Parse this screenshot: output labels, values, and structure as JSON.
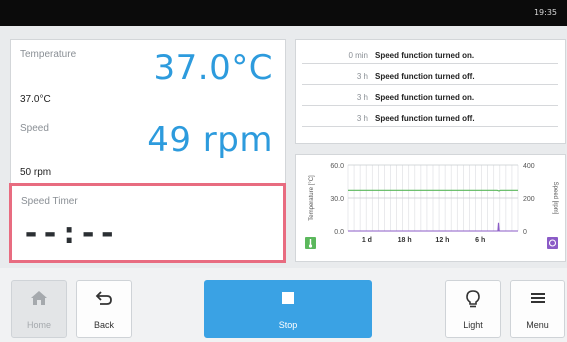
{
  "status": {
    "clock": "19:35"
  },
  "parameters": {
    "temperature": {
      "label": "Temperature",
      "actual": "37.0°C",
      "setpoint": "37.0°C"
    },
    "speed": {
      "label": "Speed",
      "actual": "49 rpm",
      "setpoint": "50 rpm"
    },
    "speed_timer": {
      "label": "Speed Timer",
      "value": "--:--"
    }
  },
  "event_log": [
    {
      "time": "0 min",
      "message": "Speed function turned on."
    },
    {
      "time": "3 h",
      "message": "Speed function turned off."
    },
    {
      "time": "3 h",
      "message": "Speed function turned on."
    },
    {
      "time": "3 h",
      "message": "Speed function turned off."
    }
  ],
  "chart_data": {
    "type": "line",
    "ylabel": "Temperature [°C]",
    "y2label": "Speed [rpm]",
    "ylim": [
      0,
      60
    ],
    "y_ticks": [
      "60.0",
      "30.0",
      "0.0"
    ],
    "y2lim": [
      0,
      400
    ],
    "y2_ticks": [
      "400",
      "200",
      "0"
    ],
    "x_ticks": [
      "1 d",
      "18 h",
      "12 h",
      "6 h"
    ],
    "xlim_hours_ago": [
      27,
      0
    ],
    "grid": true,
    "series": [
      {
        "axis": "left",
        "color": "#5bb85c",
        "points": [
          [
            27,
            37.0
          ],
          [
            3.3,
            37.0
          ],
          [
            3.0,
            36.4
          ],
          [
            2.8,
            37.0
          ],
          [
            0,
            37.0
          ]
        ]
      },
      {
        "axis": "right",
        "color": "#8b5bc7",
        "points": [
          [
            27,
            0
          ],
          [
            3.2,
            0
          ],
          [
            3.1,
            50
          ],
          [
            3.0,
            0
          ],
          [
            0,
            0
          ]
        ]
      }
    ],
    "icons": {
      "left": "thermometer-icon",
      "right": "rotation-icon"
    },
    "colors": {
      "left": "#5bb85c",
      "right": "#8b5bc7"
    }
  },
  "toolbar": {
    "home_label": "Home",
    "back_label": "Back",
    "stop_label": "Stop",
    "light_label": "Light",
    "menu_label": "Menu"
  },
  "theme": {
    "accent": "#3aa2e4",
    "highlight": "#e86c80"
  }
}
